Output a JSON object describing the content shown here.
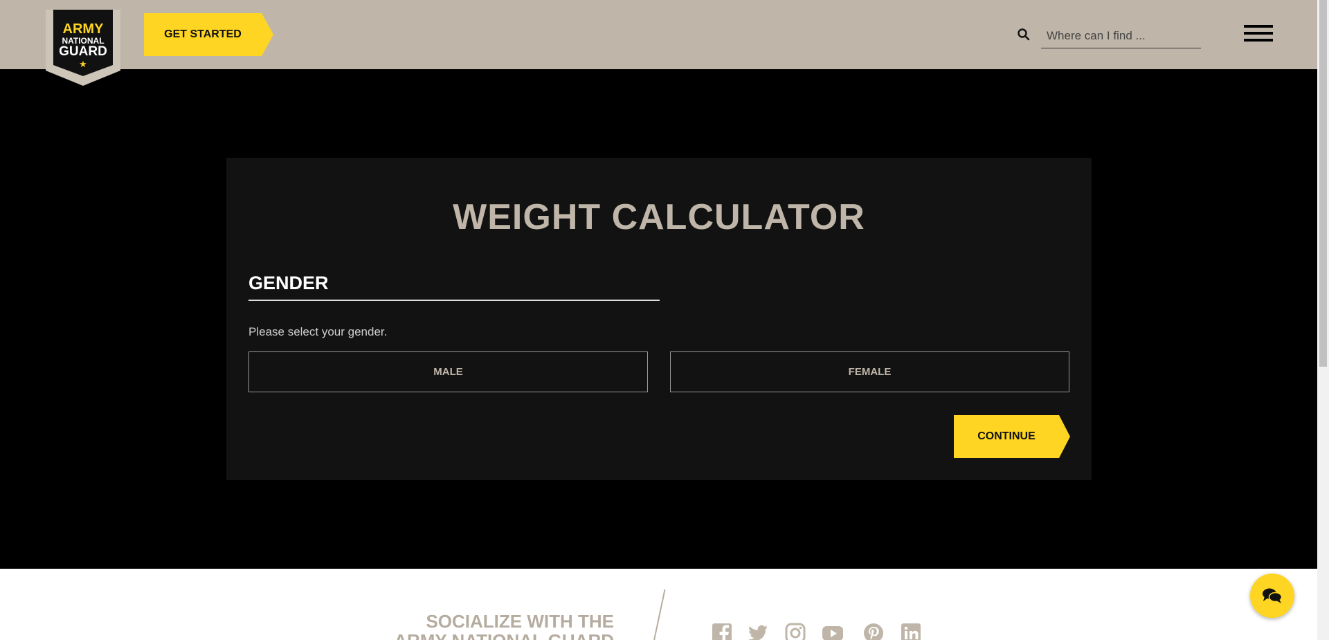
{
  "header": {
    "logo_text": [
      "ARMY",
      "NATIONAL",
      "GUARD"
    ],
    "cta_label": "GET STARTED",
    "search_placeholder": "Where can I find ..."
  },
  "calculator": {
    "title": "WEIGHT CALCULATOR",
    "section": "GENDER",
    "prompt": "Please select your gender.",
    "options": [
      "MALE",
      "FEMALE"
    ],
    "continue_label": "CONTINUE"
  },
  "footer": {
    "social_title_line1": "SOCIALIZE WITH THE",
    "social_title_line2": "ARMY NATIONAL GUARD",
    "social_icons": [
      "facebook-icon",
      "twitter-icon",
      "instagram-icon",
      "youtube-icon",
      "pinterest-icon",
      "linkedin-icon"
    ]
  },
  "colors": {
    "accent": "#ffd523",
    "header_bg": "#bfb6a9",
    "card_bg": "#121212"
  }
}
